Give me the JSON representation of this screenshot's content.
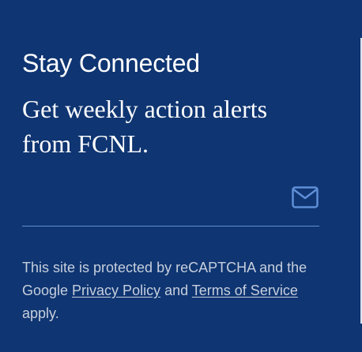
{
  "section": {
    "title": "Stay Connected",
    "subtitle": "Get weekly action alerts from FCNL."
  },
  "signup": {
    "email_value": "",
    "email_placeholder": "",
    "email_icon": "envelope-icon"
  },
  "legal": {
    "text_before": "This site is protected by reCAPTCHA and the Google ",
    "privacy_link": "Privacy Policy",
    "text_middle": " and ",
    "terms_link": "Terms of Service",
    "text_after": " apply."
  },
  "colors": {
    "background": "#0f3572",
    "heading": "#ffffff",
    "body_text": "#c6cfdd",
    "accent": "#5f8fd7"
  }
}
